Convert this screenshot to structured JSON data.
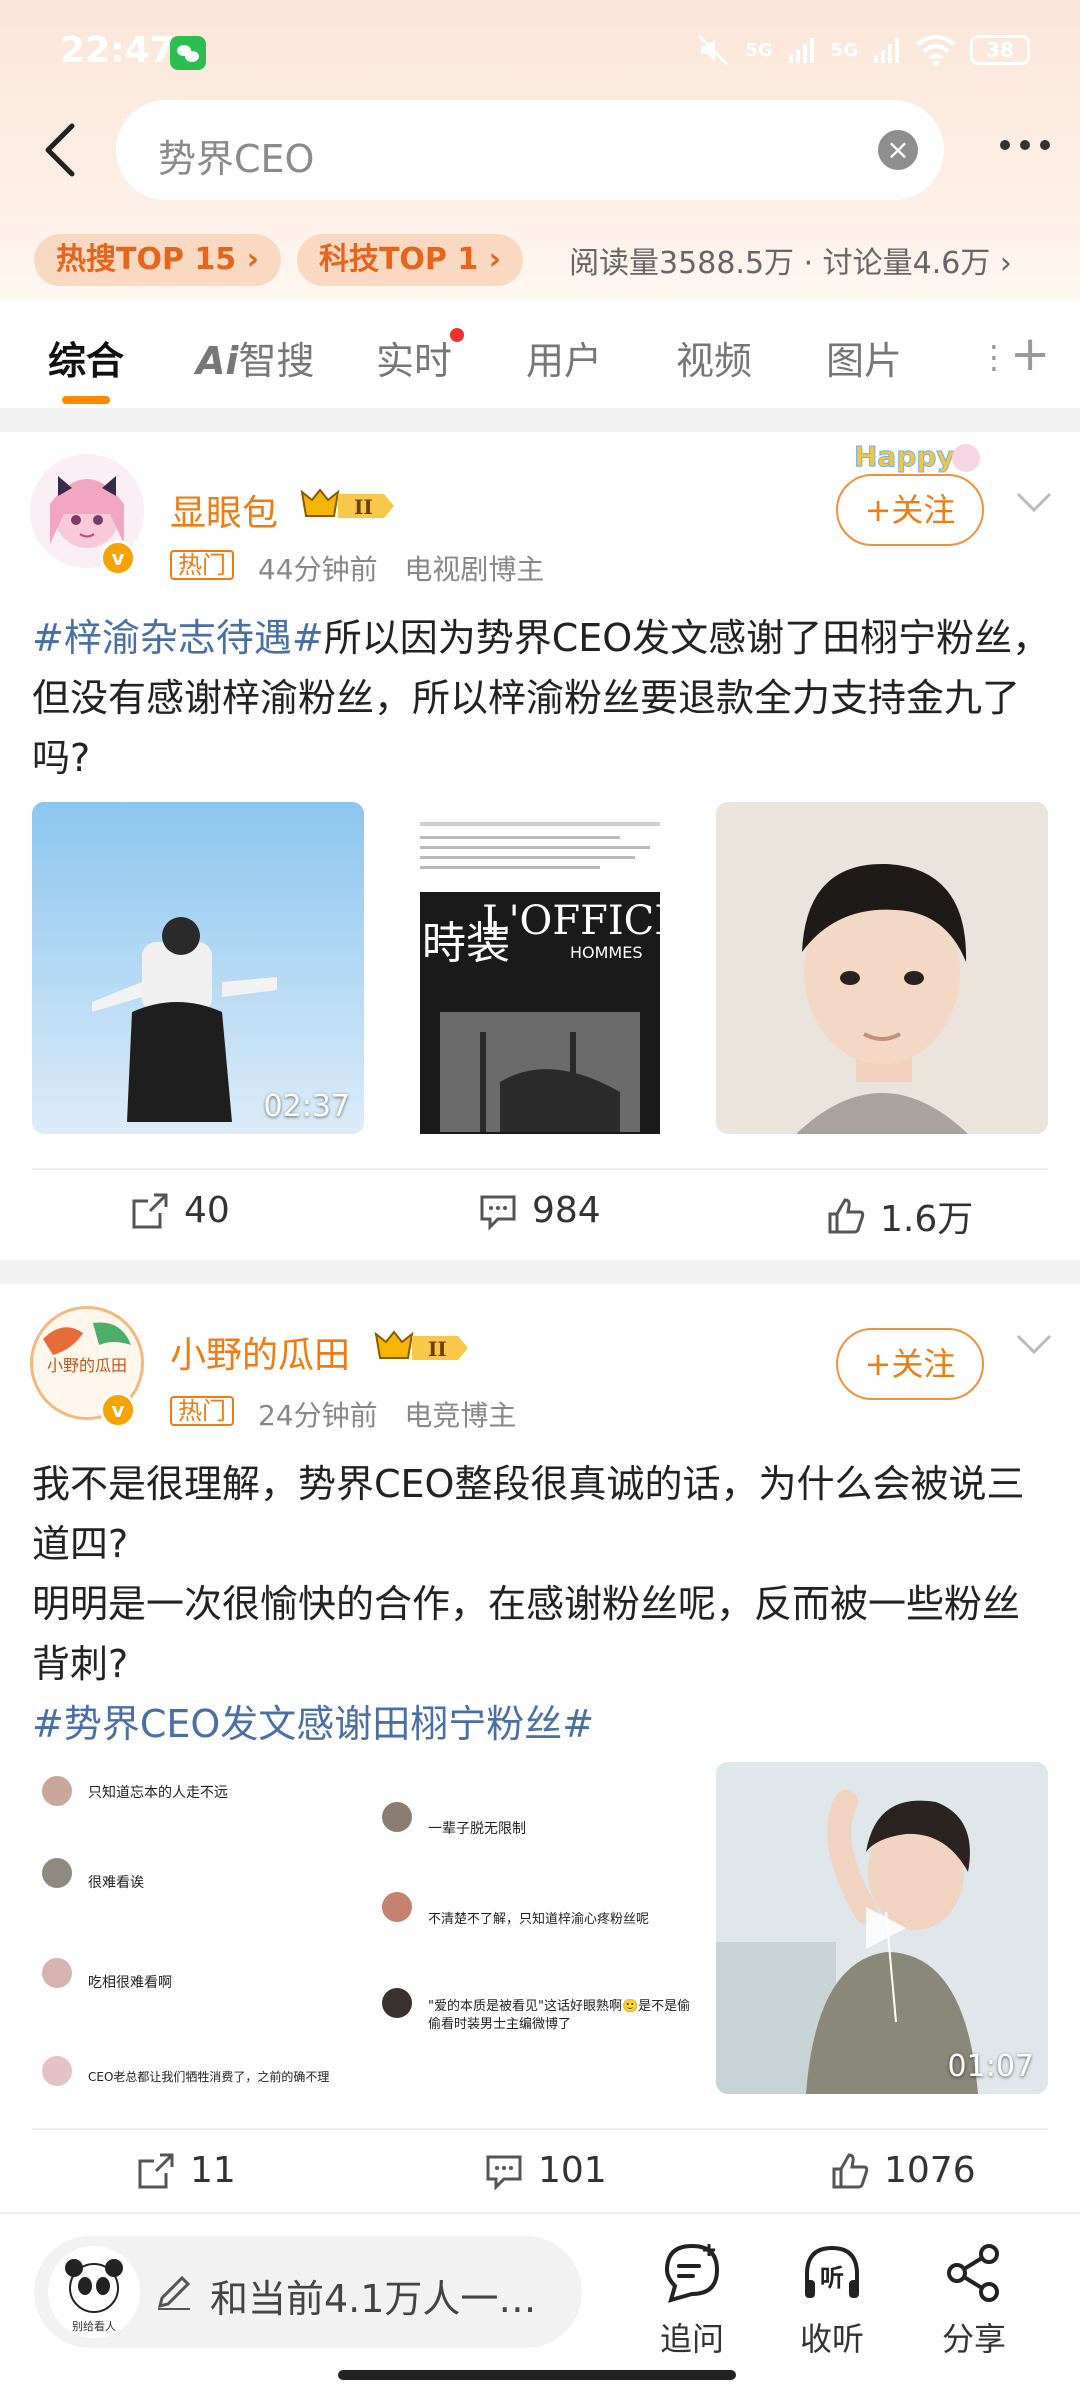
{
  "status_bar": {
    "time": "22:47",
    "signal_1": "5G",
    "signal_2": "5G",
    "battery": "38"
  },
  "search": {
    "query": "势界CEO"
  },
  "trend_pills": [
    {
      "label": "热搜TOP 15 ›"
    },
    {
      "label": "科技TOP 1 ›"
    }
  ],
  "stats_text": "阅读量3588.5万 · 讨论量4.6万 ›",
  "tabs": [
    {
      "label": "综合",
      "active": true
    },
    {
      "label": "智搜",
      "prefix": "Ai"
    },
    {
      "label": "实时",
      "dot": true
    },
    {
      "label": "用户"
    },
    {
      "label": "视频"
    },
    {
      "label": "图片"
    }
  ],
  "posts": [
    {
      "username": "显眼包",
      "rank": "II",
      "hot_tag": "热门",
      "time": "44分钟前",
      "role": "电视剧博主",
      "follow_label": "+关注",
      "avatar_deco": "Happy",
      "text_hashtag": "#梓渝杂志待遇#",
      "text_body": "所以因为势界CEO发文感谢了田栩宁粉丝，但没有感谢梓渝粉丝，所以梓渝粉丝要退款全力支持金九了吗?",
      "video_duration": "02:37",
      "magazine_title": "L'OFFICIEL",
      "magazine_sub": "HOMMES",
      "magazine_kanji": "時装",
      "reposts": "40",
      "comments": "984",
      "likes": "1.6万"
    },
    {
      "username": "小野的瓜田",
      "rank": "II",
      "hot_tag": "热门",
      "time": "24分钟前",
      "role": "电竞博主",
      "follow_label": "+关注",
      "avatar_text": "小野的瓜田",
      "text_line1": "我不是很理解，势界CEO整段很真诚的话，为什么会被说三道四?",
      "text_line2": "明明是一次很愉快的合作，在感谢粉丝呢，反而被一些粉丝背刺?",
      "text_hashtag": "#势界CEO发文感谢田栩宁粉丝#",
      "comments_left": [
        "只知道忘本的人走不远",
        "很难看诶",
        "吃相很难看啊",
        "CEO老总都让我们牺牲消费了，之前的确不理"
      ],
      "comments_mid": [
        "一辈子脱无限制",
        "不清楚不了解，只知道梓渝心疼粉丝呢",
        "\"爱的本质是被看见\"这话好眼熟啊🙂是不是偷偷看时装男士主编微博了"
      ],
      "video_duration": "01:07",
      "reposts": "11",
      "comments": "101",
      "likes": "1076"
    }
  ],
  "bottom_bar": {
    "ask_placeholder": "和当前4.1万人一…",
    "ask_avatar_text": "别给看人",
    "actions": [
      {
        "label": "追问",
        "icon": "chat-plus-icon"
      },
      {
        "label": "收听",
        "icon": "headphone-icon",
        "glyph": "听"
      },
      {
        "label": "分享",
        "icon": "share-icon"
      }
    ]
  }
}
